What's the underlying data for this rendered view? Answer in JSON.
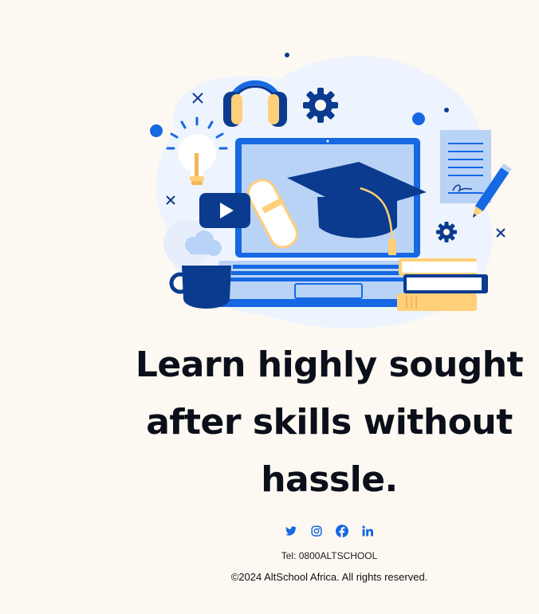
{
  "hero": {
    "headline": "Learn highly sought after skills without hassle."
  },
  "social": [
    {
      "icon": "twitter-icon"
    },
    {
      "icon": "instagram-icon"
    },
    {
      "icon": "facebook-icon"
    },
    {
      "icon": "linkedin-icon"
    }
  ],
  "footer": {
    "tel": "Tel: 0800ALTSCHOOL",
    "copyright": "©2024 AltSchool Africa. All rights reserved."
  },
  "colors": {
    "background": "#fdf9f2",
    "brand_blue": "#1668e3",
    "navy": "#0b3b8f",
    "light_blue": "#b9d3f7",
    "accent_yellow": "#ffcf7a"
  }
}
